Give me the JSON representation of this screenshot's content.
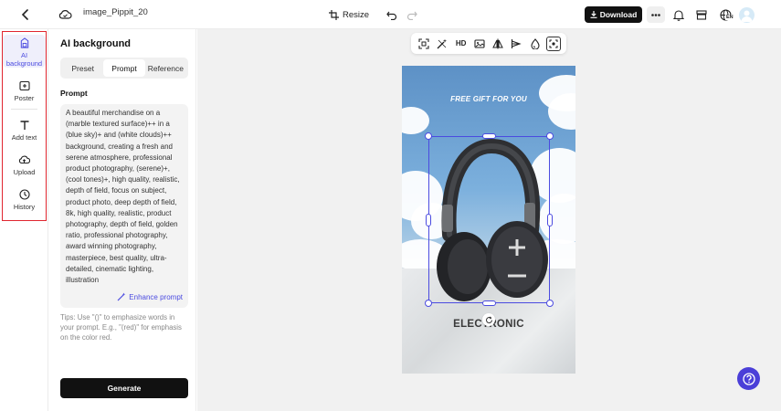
{
  "header": {
    "filename": "image_Pippit_20",
    "resize_label": "Resize",
    "download_label": "Download",
    "language_badge": "EN"
  },
  "rail": {
    "items": [
      {
        "label": "AI background",
        "icon": "ai-background-icon",
        "active": true
      },
      {
        "label": "Poster",
        "icon": "poster-icon"
      },
      {
        "label": "Add text",
        "icon": "text-icon"
      },
      {
        "label": "Upload",
        "icon": "upload-icon"
      },
      {
        "label": "History",
        "icon": "history-icon"
      }
    ],
    "highlight_color": "#e0262f"
  },
  "panel": {
    "title": "AI background",
    "tabs": [
      {
        "label": "Preset"
      },
      {
        "label": "Prompt",
        "active": true
      },
      {
        "label": "Reference"
      }
    ],
    "prompt_label": "Prompt",
    "prompt_text": "A beautiful merchandise on a (marble textured surface)++ in a (blue sky)+ and (white clouds)++ background, creating a fresh and serene atmosphere, professional product photography, (serene)+, (cool tones)+, high quality, realistic, depth of field, focus on subject, product photo, deep depth of field, 8k, high quality, realistic, product photography, depth of field, golden ratio, professional photography, award winning photography, masterpiece, best quality, ultra-detailed, cinematic lighting, illustration",
    "enhance_label": "Enhance prompt",
    "tips": "Tips: Use \"()\" to emphasize words in your prompt. E.g., \"(red)\" for emphasis on the color red.",
    "generate_label": "Generate"
  },
  "canvas": {
    "toolbar": [
      {
        "icon": "cutout-icon"
      },
      {
        "icon": "magic-eraser-icon"
      },
      {
        "icon": "hd-icon",
        "label": "HD"
      },
      {
        "icon": "image-edit-icon"
      },
      {
        "icon": "flip-icon"
      },
      {
        "icon": "align-icon"
      },
      {
        "icon": "opacity-icon"
      },
      {
        "icon": "select-area-icon"
      }
    ],
    "artboard": {
      "top_text": "FREE GIFT FOR YOU",
      "bottom_text": "ELECTRONIC"
    }
  },
  "colors": {
    "accent": "#4b4be0",
    "help_button": "#4b3fd8"
  }
}
